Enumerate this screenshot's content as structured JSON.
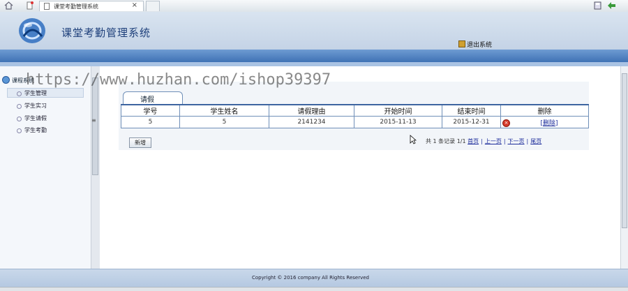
{
  "browser": {
    "tab_title": "课堂考勤管理系统",
    "tab_close": "×"
  },
  "header": {
    "title": "课堂考勤管理系统",
    "logout_label": "退出系统"
  },
  "sidebar": {
    "section_title": "课程系统",
    "items": [
      {
        "label": "学生管理"
      },
      {
        "label": "学生实习"
      },
      {
        "label": "学生请假"
      },
      {
        "label": "学生考勤"
      }
    ],
    "grip": "≡"
  },
  "main": {
    "tab_label": "请假",
    "table": {
      "headers": [
        "学号",
        "学生姓名",
        "请假理由",
        "开始时间",
        "结束时间",
        "删除"
      ],
      "rows": [
        {
          "id": "5",
          "name": "5",
          "reason": "2141234",
          "start": "2015-11-13",
          "end": "2015-12-31",
          "delete_label": "[删除]"
        }
      ]
    },
    "add_button": "新增",
    "pager": {
      "summary": "共 1 条记录 1/1",
      "first": "首页",
      "prev": "上一页",
      "next": "下一页",
      "last": "尾页"
    }
  },
  "footer": {
    "copyright": "Copyright © 2016 company All Rights Reserved"
  },
  "watermark": "https://www.huzhan.com/ishop39397",
  "colors": {
    "header_band": "#3f72b5",
    "table_border": "#6f8fb8",
    "link": "#1a2a9a",
    "title": "#1d3f7a"
  }
}
